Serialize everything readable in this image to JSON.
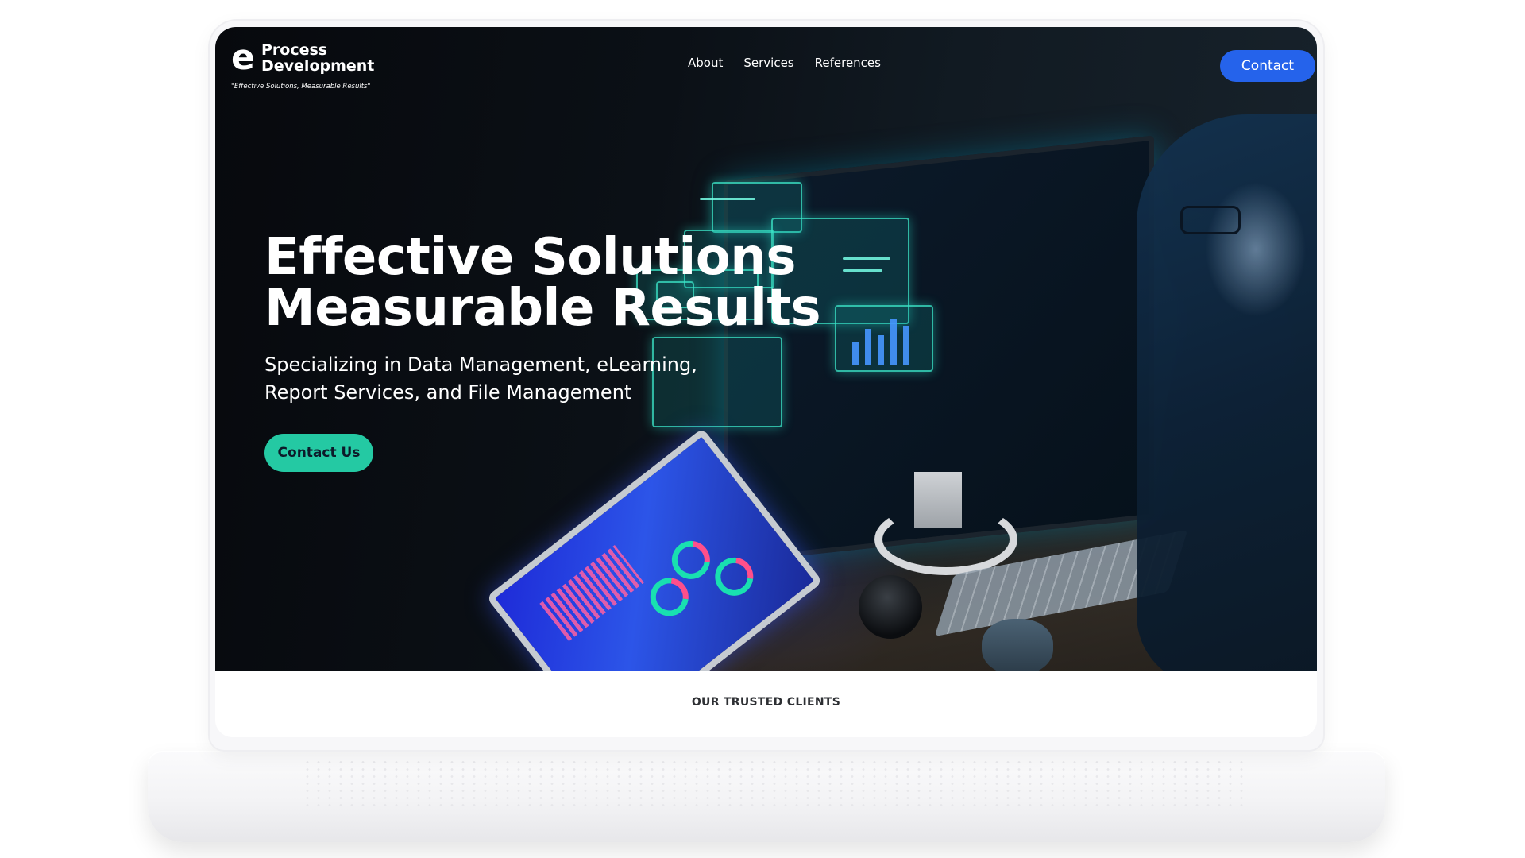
{
  "nav": {
    "logo_mark": "e",
    "logo_line1": "Process",
    "logo_line2": "Development",
    "logo_tagline": "\"Effective Solutions, Measurable Results\"",
    "links": [
      "About",
      "Services",
      "References"
    ],
    "contact_label": "Contact"
  },
  "hero": {
    "title_line1": "Effective Solutions",
    "title_line2": "Measurable Results",
    "subtitle_line1": "Specializing in Data Management, eLearning,",
    "subtitle_line2": "Report Services, and File Management",
    "cta_label": "Contact Us"
  },
  "clients": {
    "heading": "OUR TRUSTED CLIENTS"
  },
  "colors": {
    "accent_blue": "#2563eb",
    "accent_teal": "#24c9a3",
    "hero_dark": "#0b1016"
  }
}
